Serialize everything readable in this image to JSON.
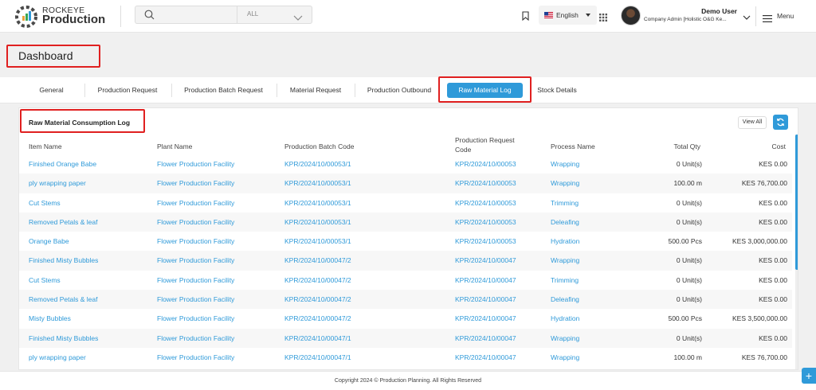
{
  "header": {
    "brand_top": "ROCKEYE",
    "brand_main": "Production",
    "search": {
      "placeholder": "",
      "scope": "ALL"
    },
    "language": "English",
    "user_name": "Demo User",
    "user_role": "Company Admin [Holistic O&G Ke...",
    "menu_label": "Menu"
  },
  "page_title": "Dashboard",
  "tabs": [
    {
      "label": "General"
    },
    {
      "label": "Production Request"
    },
    {
      "label": "Production Batch Request"
    },
    {
      "label": "Material Request"
    },
    {
      "label": "Production Outbound"
    },
    {
      "label": "Raw Material Log",
      "active": true
    },
    {
      "label": "Stock Details"
    }
  ],
  "panel": {
    "title": "Raw Material Consumption Log",
    "view_all": "View All",
    "columns": {
      "item_name": "Item Name",
      "plant_name": "Plant Name",
      "batch_code": "Production Batch Code",
      "request_code_1": "Production Request",
      "request_code_2": "Code",
      "process_name": "Process Name",
      "total_qty": "Total Qty",
      "cost": "Cost"
    },
    "rows": [
      {
        "item": "Finished Orange Babe",
        "plant": "Flower Production Facility",
        "batch": "KPR/2024/10/00053/1",
        "request": "KPR/2024/10/00053",
        "process": "Wrapping",
        "qty": "0 Unit(s)",
        "cost": "KES 0.00"
      },
      {
        "item": "ply wrapping paper",
        "plant": "Flower Production Facility",
        "batch": "KPR/2024/10/00053/1",
        "request": "KPR/2024/10/00053",
        "process": "Wrapping",
        "qty": "100.00 m",
        "cost": "KES 76,700.00"
      },
      {
        "item": "Cut Stems",
        "plant": "Flower Production Facility",
        "batch": "KPR/2024/10/00053/1",
        "request": "KPR/2024/10/00053",
        "process": "Trimming",
        "qty": "0 Unit(s)",
        "cost": "KES 0.00"
      },
      {
        "item": "Removed Petals & leaf",
        "plant": "Flower Production Facility",
        "batch": "KPR/2024/10/00053/1",
        "request": "KPR/2024/10/00053",
        "process": "Deleafing",
        "qty": "0 Unit(s)",
        "cost": "KES 0.00"
      },
      {
        "item": "Orange Babe",
        "plant": "Flower Production Facility",
        "batch": "KPR/2024/10/00053/1",
        "request": "KPR/2024/10/00053",
        "process": "Hydration",
        "qty": "500.00 Pcs",
        "cost": "KES 3,000,000.00"
      },
      {
        "item": "Finished Misty Bubbles",
        "plant": "Flower Production Facility",
        "batch": "KPR/2024/10/00047/2",
        "request": "KPR/2024/10/00047",
        "process": "Wrapping",
        "qty": "0 Unit(s)",
        "cost": "KES 0.00"
      },
      {
        "item": "Cut Stems",
        "plant": "Flower Production Facility",
        "batch": "KPR/2024/10/00047/2",
        "request": "KPR/2024/10/00047",
        "process": "Trimming",
        "qty": "0 Unit(s)",
        "cost": "KES 0.00"
      },
      {
        "item": "Removed Petals & leaf",
        "plant": "Flower Production Facility",
        "batch": "KPR/2024/10/00047/2",
        "request": "KPR/2024/10/00047",
        "process": "Deleafing",
        "qty": "0 Unit(s)",
        "cost": "KES 0.00"
      },
      {
        "item": "Misty Bubbles",
        "plant": "Flower Production Facility",
        "batch": "KPR/2024/10/00047/2",
        "request": "KPR/2024/10/00047",
        "process": "Hydration",
        "qty": "500.00 Pcs",
        "cost": "KES 3,500,000.00"
      },
      {
        "item": "Finished Misty Bubbles",
        "plant": "Flower Production Facility",
        "batch": "KPR/2024/10/00047/1",
        "request": "KPR/2024/10/00047",
        "process": "Wrapping",
        "qty": "0 Unit(s)",
        "cost": "KES 0.00"
      },
      {
        "item": "ply wrapping paper",
        "plant": "Flower Production Facility",
        "batch": "KPR/2024/10/00047/1",
        "request": "KPR/2024/10/00047",
        "process": "Wrapping",
        "qty": "100.00 m",
        "cost": "KES 76,700.00"
      }
    ]
  },
  "footer": "Copyright 2024 © Production Planning. All Rights Reserved",
  "colors": {
    "accent": "#2f9ad9",
    "highlight_box": "#e02020"
  },
  "icons": [
    "logo-icon",
    "search-icon",
    "chevron-down-icon",
    "bookmark-icon",
    "us-flag-icon",
    "apps-grid-icon",
    "hamburger-menu-icon",
    "refresh-icon",
    "plus-icon"
  ]
}
